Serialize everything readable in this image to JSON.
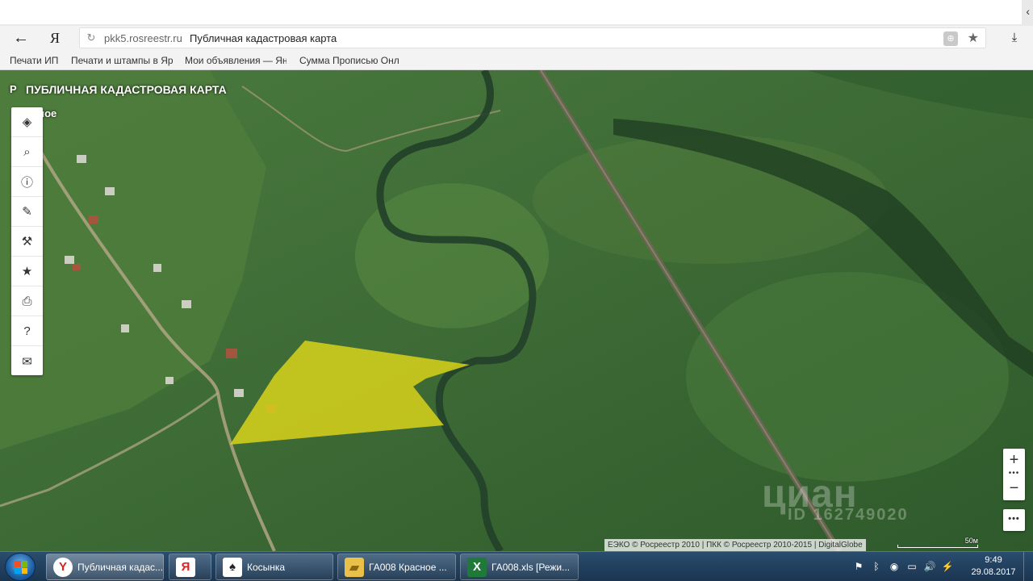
{
  "browser": {
    "tab_chevron": "‹",
    "nav_back": "←",
    "yandex_logo": "Я",
    "reload": "↻",
    "domain": "pkk5.rosreestr.ru",
    "page_title": "Публичная кадастровая карта",
    "protect": "⊕",
    "star": "★",
    "download": "⤓"
  },
  "bookmarks": [
    "Печати ИП",
    "Печати и штампы в Яр",
    "Мои объявления — Ян",
    "Сумма Прописью Онл"
  ],
  "map": {
    "title": "ПУБЛИЧНАЯ КАДАСТРОВАЯ КАРТА",
    "logo": "P",
    "place_label": "сное",
    "tools": [
      "layers-icon",
      "search-icon",
      "info-icon",
      "pencil-icon",
      "ruler-icon",
      "star-icon",
      "print-icon",
      "help-icon",
      "mail-icon"
    ],
    "tool_glyphs": [
      "◈",
      "⌕",
      "ⓘ",
      "✎",
      "⚒",
      "★",
      "⎙",
      "?",
      "✉"
    ],
    "zoom_in": "+",
    "zoom_dots": "•••",
    "zoom_out": "−",
    "more": "•••",
    "attribution": "ЕЭКО © Росреестр 2010 | ПКК © Росреестр 2010-2015 | DigitalGlobe",
    "scale_label": "50м",
    "watermark": "циан",
    "watermark_id": "ID 162749020",
    "colors": {
      "parcel": "#d8d21a",
      "grass": "#3f6b37",
      "river": "#26402a"
    }
  },
  "taskbar": {
    "tasks": [
      {
        "label": "Публичная кадас...",
        "icon": "Y",
        "color": "#e02020"
      },
      {
        "label": "",
        "icon": "Я",
        "color": "#e02020"
      },
      {
        "label": "Косынка",
        "icon": "♠",
        "color": "#ffffff"
      },
      {
        "label": "ГА008 Красное ...",
        "icon": "▰",
        "color": "#e8c04a"
      },
      {
        "label": "ГА008.xls [Режи...",
        "icon": "X",
        "color": "#1f7a3a"
      }
    ],
    "tray": [
      "⚑",
      "ᛒ",
      "◉",
      "▭",
      "🔊",
      "⚡"
    ],
    "time": "9:49",
    "date": "29.08.2017"
  }
}
